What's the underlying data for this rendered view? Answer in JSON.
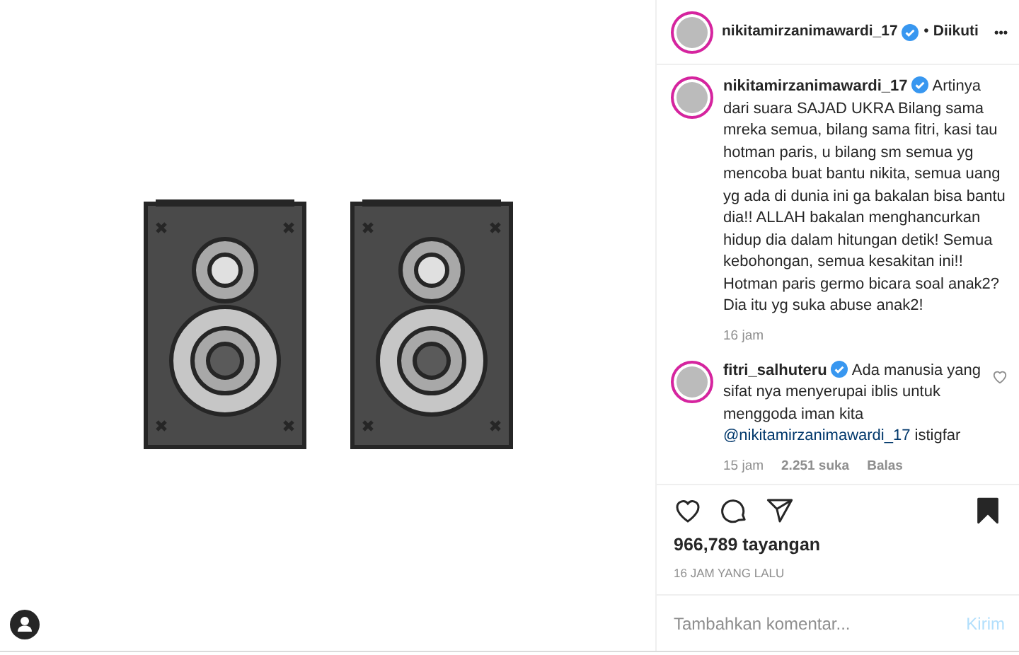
{
  "post_header": {
    "username": "nikitamirzanimawardi_17",
    "verified": true,
    "separator": "•",
    "follow_status": "Diikuti",
    "more": "•••"
  },
  "caption": {
    "username": "nikitamirzanimawardi_17",
    "verified": true,
    "text": "Artinya dari suara SAJAD UKRA Bilang sama mreka semua, bilang sama fitri, kasi tau hotman paris, u bilang sm semua yg mencoba buat bantu nikita, semua uang yg ada di dunia ini ga bakalan bisa bantu dia!! ALLAH bakalan menghancurkan hidup dia dalam hitungan detik! Semua kebohongan, semua kesakitan ini!! Hotman paris germo bicara soal anak2? Dia itu yg suka abuse anak2!",
    "time": "16 jam"
  },
  "comments": [
    {
      "username": "fitri_salhuteru",
      "verified": true,
      "text": "Ada manusia yang sifat nya menyerupai iblis untuk menggoda iman kita",
      "mention": "@nikitamirzanimawardi_17",
      "text_after": "istigfar",
      "time": "15 jam",
      "likes": "2.251 suka",
      "reply": "Balas",
      "liked": false
    }
  ],
  "actions": {
    "liked": false,
    "saved": true
  },
  "views": "966,789 tayangan",
  "posted": "16 JAM YANG LALU",
  "comment_box": {
    "placeholder": "Tambahkan komentar...",
    "submit": "Kirim"
  }
}
